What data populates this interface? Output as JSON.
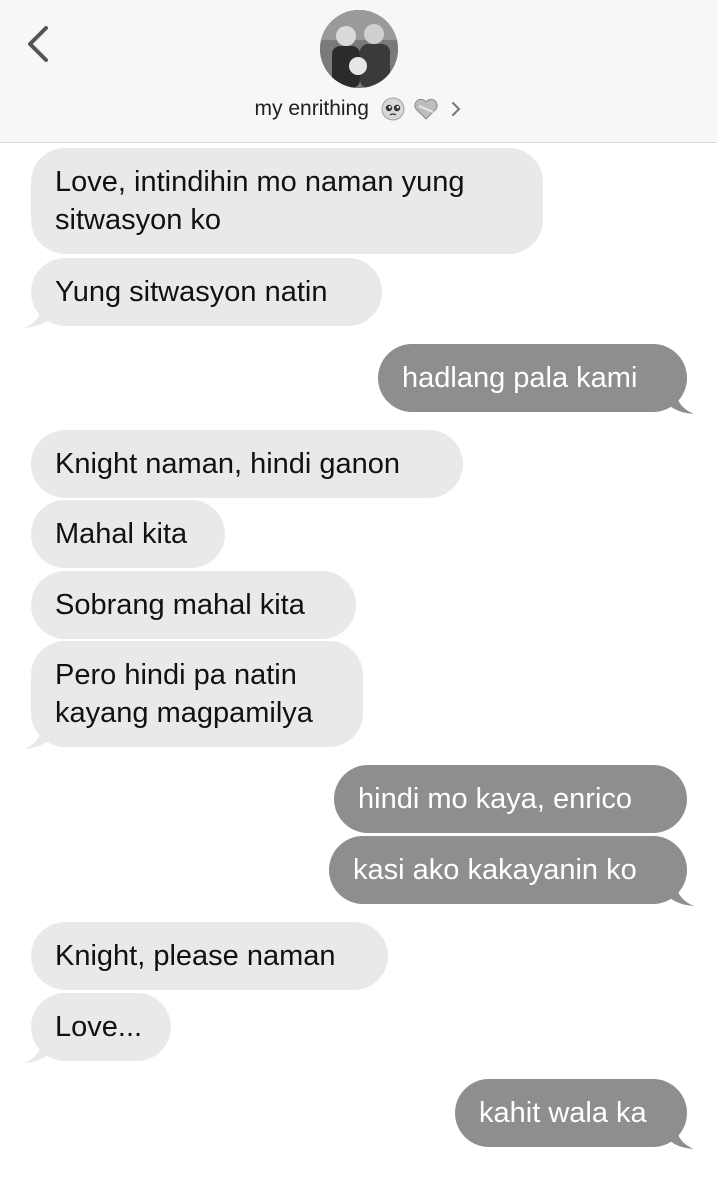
{
  "header": {
    "contact_name": "my enrithing",
    "emoji_1": "pleading-face",
    "emoji_2": "heart",
    "back_icon": "chevron-left-icon",
    "detail_icon": "chevron-right-icon"
  },
  "messages": [
    {
      "dir": "in",
      "lines": [
        "Love, intindihin mo naman yung",
        "sitwasyon ko"
      ]
    },
    {
      "dir": "in",
      "lines": [
        "Yung sitwasyon natin"
      ]
    },
    {
      "dir": "out",
      "lines": [
        "hadlang pala kami"
      ]
    },
    {
      "dir": "in",
      "lines": [
        "Knight naman, hindi ganon"
      ]
    },
    {
      "dir": "in",
      "lines": [
        "Mahal kita"
      ]
    },
    {
      "dir": "in",
      "lines": [
        "Sobrang mahal kita"
      ]
    },
    {
      "dir": "in",
      "lines": [
        "Pero hindi pa natin",
        "kayang magpamilya"
      ]
    },
    {
      "dir": "out",
      "lines": [
        "hindi mo kaya, enrico"
      ]
    },
    {
      "dir": "out",
      "lines": [
        "kasi ako kakayanin ko"
      ]
    },
    {
      "dir": "in",
      "lines": [
        "Knight, please naman"
      ]
    },
    {
      "dir": "in",
      "lines": [
        "Love..."
      ]
    },
    {
      "dir": "out",
      "lines": [
        "kahit wala ka"
      ]
    }
  ],
  "colors": {
    "incoming_bubble": "#e9e9e9",
    "outgoing_bubble": "#8e8e8e",
    "header_bg": "#f7f7f7"
  }
}
